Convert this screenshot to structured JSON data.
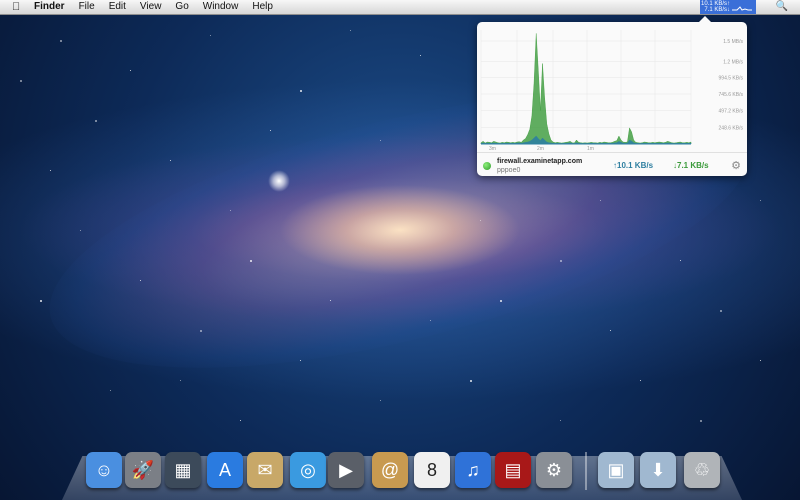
{
  "menubar": {
    "app_name": "Finder",
    "items": [
      "File",
      "Edit",
      "View",
      "Go",
      "Window",
      "Help"
    ],
    "status_line1": "10.1 KB/s↑",
    "status_line2": "7.1 KB/s↓"
  },
  "popover": {
    "host": "firewall.examinetapp.com",
    "interface": "pppoe0",
    "upload": "↑10.1 KB/s",
    "download": "↓7.1 KB/s"
  },
  "chart_data": {
    "type": "area",
    "ylabels": [
      "1.5 MB/s",
      "1.2 MB/s",
      "994.5 KB/s",
      "745.6 KB/s",
      "497.2 KB/s",
      "248.6 KB/s"
    ],
    "xlabels": [
      "3m",
      "2m",
      "1m"
    ],
    "yticks_kbs": [
      1536,
      1229,
      994.5,
      745.6,
      497.2,
      248.6
    ],
    "ymax_kbs": 1700,
    "series": [
      {
        "color": "#3a9a3a",
        "values": [
          20,
          40,
          15,
          30,
          25,
          20,
          40,
          30,
          20,
          15,
          25,
          20,
          30,
          25,
          20,
          25,
          20,
          30,
          35,
          25,
          60,
          80,
          140,
          220,
          420,
          900,
          1650,
          1100,
          500,
          1200,
          700,
          300,
          150,
          60,
          30,
          20,
          25,
          20,
          15,
          20,
          25,
          30,
          40,
          20,
          15,
          60,
          25,
          20,
          15,
          20,
          15,
          20,
          25,
          20,
          20,
          15,
          25,
          20,
          30,
          25,
          20,
          20,
          25,
          40,
          50,
          120,
          60,
          30,
          25,
          30,
          240,
          180,
          60,
          25,
          20,
          15,
          20,
          30,
          25,
          20,
          20,
          25,
          20,
          25,
          30,
          25,
          20,
          25,
          40,
          30,
          20,
          15,
          20,
          25,
          30,
          20,
          20,
          25,
          20,
          30
        ]
      },
      {
        "color": "#2e7fa0",
        "values": [
          10,
          15,
          12,
          14,
          10,
          12,
          15,
          12,
          10,
          8,
          12,
          10,
          14,
          12,
          10,
          12,
          10,
          15,
          16,
          12,
          20,
          24,
          30,
          40,
          60,
          90,
          120,
          80,
          50,
          90,
          60,
          30,
          20,
          15,
          12,
          10,
          12,
          10,
          8,
          10,
          12,
          14,
          16,
          10,
          8,
          20,
          12,
          10,
          8,
          10,
          8,
          10,
          12,
          10,
          10,
          8,
          12,
          10,
          14,
          12,
          10,
          10,
          12,
          16,
          20,
          40,
          25,
          14,
          12,
          14,
          60,
          45,
          20,
          12,
          10,
          8,
          10,
          14,
          12,
          10,
          10,
          12,
          10,
          12,
          14,
          12,
          10,
          12,
          16,
          14,
          10,
          8,
          10,
          12,
          14,
          10,
          10,
          12,
          10,
          14
        ]
      }
    ]
  },
  "dock": {
    "items": [
      {
        "name": "finder-icon",
        "color": "#4a8fe0",
        "glyph": "☺"
      },
      {
        "name": "launchpad-icon",
        "color": "#7b7f86",
        "glyph": "🚀"
      },
      {
        "name": "mission-control-icon",
        "color": "#3c4a5a",
        "glyph": "▦"
      },
      {
        "name": "app-store-icon",
        "color": "#2a7be0",
        "glyph": "A"
      },
      {
        "name": "mail-stamp-icon",
        "color": "#c8a868",
        "glyph": "✉"
      },
      {
        "name": "safari-icon",
        "color": "#3a9ae0",
        "glyph": "◎"
      },
      {
        "name": "facetime-icon",
        "color": "#5a5f68",
        "glyph": "▶"
      },
      {
        "name": "address-book-icon",
        "color": "#c89a50",
        "glyph": "@"
      },
      {
        "name": "ical-icon",
        "color": "#f0f0f0",
        "glyph": "8"
      },
      {
        "name": "itunes-icon",
        "color": "#2f72d8",
        "glyph": "♫"
      },
      {
        "name": "photo-booth-icon",
        "color": "#a81818",
        "glyph": "▤"
      },
      {
        "name": "system-preferences-icon",
        "color": "#8a8f96",
        "glyph": "⚙"
      },
      {
        "name": "applications-folder-icon",
        "color": "#a0b8d0",
        "glyph": "▣"
      },
      {
        "name": "downloads-folder-icon",
        "color": "#a0b8d0",
        "glyph": "⬇"
      },
      {
        "name": "trash-icon",
        "color": "#b0b4b8",
        "glyph": "♲"
      }
    ]
  }
}
